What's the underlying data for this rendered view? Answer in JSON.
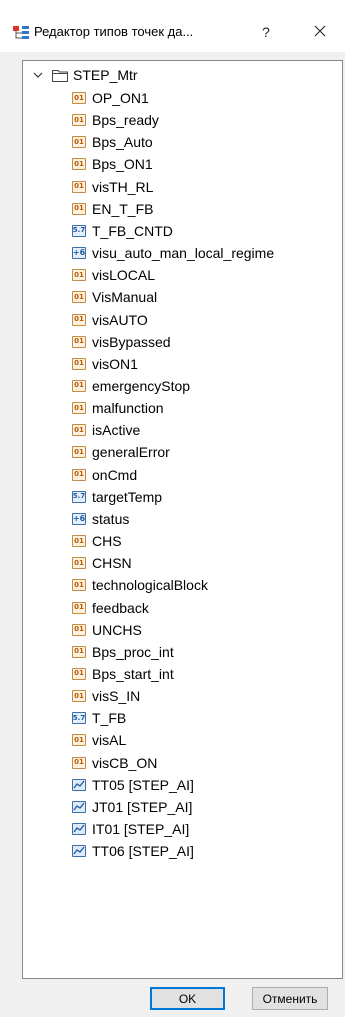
{
  "window": {
    "title": "Редактор типов точек да...",
    "help_label": "?"
  },
  "tree": {
    "root": {
      "label": "STEP_Mtr",
      "expanded": true
    },
    "items": [
      {
        "label": "OP_ON1",
        "type": "bool",
        "icon_text": "01"
      },
      {
        "label": "Bps_ready",
        "type": "bool",
        "icon_text": "01"
      },
      {
        "label": "Bps_Auto",
        "type": "bool",
        "icon_text": "01"
      },
      {
        "label": "Bps_ON1",
        "type": "bool",
        "icon_text": "01"
      },
      {
        "label": "visTH_RL",
        "type": "bool",
        "icon_text": "01"
      },
      {
        "label": "EN_T_FB",
        "type": "bool",
        "icon_text": "01"
      },
      {
        "label": "T_FB_CNTD",
        "type": "real",
        "icon_text": "5.7"
      },
      {
        "label": "visu_auto_man_local_regime",
        "type": "int",
        "icon_text": "+6"
      },
      {
        "label": "visLOCAL",
        "type": "bool",
        "icon_text": "01"
      },
      {
        "label": "VisManual",
        "type": "bool",
        "icon_text": "01"
      },
      {
        "label": "visAUTO",
        "type": "bool",
        "icon_text": "01"
      },
      {
        "label": "visBypassed",
        "type": "bool",
        "icon_text": "01"
      },
      {
        "label": "visON1",
        "type": "bool",
        "icon_text": "01"
      },
      {
        "label": "emergencyStop",
        "type": "bool",
        "icon_text": "01"
      },
      {
        "label": "malfunction",
        "type": "bool",
        "icon_text": "01"
      },
      {
        "label": "isActive",
        "type": "bool",
        "icon_text": "01"
      },
      {
        "label": "generalError",
        "type": "bool",
        "icon_text": "01"
      },
      {
        "label": "onCmd",
        "type": "bool",
        "icon_text": "01"
      },
      {
        "label": "targetTemp",
        "type": "real",
        "icon_text": "5.7"
      },
      {
        "label": "status",
        "type": "int",
        "icon_text": "+6"
      },
      {
        "label": "CHS",
        "type": "bool",
        "icon_text": "01"
      },
      {
        "label": "CHSN",
        "type": "bool",
        "icon_text": "01"
      },
      {
        "label": "technologicalBlock",
        "type": "bool",
        "icon_text": "01"
      },
      {
        "label": "feedback",
        "type": "bool",
        "icon_text": "01"
      },
      {
        "label": "UNCHS",
        "type": "bool",
        "icon_text": "01"
      },
      {
        "label": "Bps_proc_int",
        "type": "bool",
        "icon_text": "01"
      },
      {
        "label": "Bps_start_int",
        "type": "bool",
        "icon_text": "01"
      },
      {
        "label": "visS_IN",
        "type": "bool",
        "icon_text": "01"
      },
      {
        "label": "T_FB",
        "type": "real",
        "icon_text": "5.7"
      },
      {
        "label": "visAL",
        "type": "bool",
        "icon_text": "01"
      },
      {
        "label": "visCB_ON",
        "type": "bool",
        "icon_text": "01"
      },
      {
        "label": "TT05 [STEP_AI]",
        "type": "struct",
        "icon_text": ""
      },
      {
        "label": "JT01 [STEP_AI]",
        "type": "struct",
        "icon_text": ""
      },
      {
        "label": "IT01 [STEP_AI]",
        "type": "struct",
        "icon_text": ""
      },
      {
        "label": "TT06 [STEP_AI]",
        "type": "struct",
        "icon_text": ""
      }
    ]
  },
  "buttons": {
    "ok_label": "OK",
    "cancel_label": "Отменить"
  },
  "colors": {
    "accent": "#0078d7",
    "bool_icon": "#c58a43",
    "real_icon": "#3d6ea8"
  }
}
